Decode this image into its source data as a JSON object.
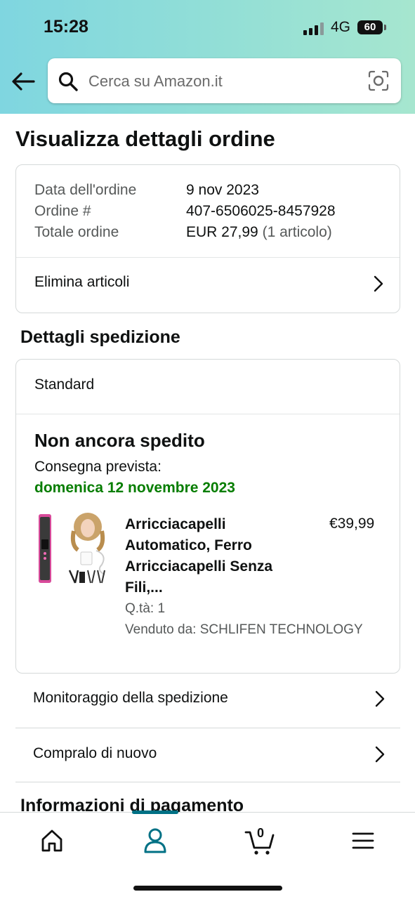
{
  "status_bar": {
    "time": "15:28",
    "network": "4G",
    "battery": "60"
  },
  "search": {
    "placeholder": "Cerca su Amazon.it"
  },
  "page": {
    "title": "Visualizza dettagli ordine"
  },
  "order": {
    "date_label": "Data dell'ordine",
    "date_value": "9 nov 2023",
    "number_label": "Ordine #",
    "number_value": "407-6506025-8457928",
    "total_label": "Totale ordine",
    "total_value": "EUR 27,99",
    "total_items": "(1 articolo)",
    "delete_items_label": "Elimina articoli"
  },
  "shipping": {
    "section_title": "Dettagli spedizione",
    "method": "Standard",
    "status": "Non ancora spedito",
    "delivery_label": "Consegna prevista:",
    "delivery_date": "domenica 12 novembre 2023",
    "product": {
      "title": "Arricciacapelli Automatico, Ferro Arricciacapelli Senza Fili,...",
      "price": "€39,99",
      "quantity": "Q.tà: 1",
      "seller": "Venduto da: SCHLIFEN TECHNOLOGY"
    }
  },
  "actions": {
    "track_label": "Monitoraggio della spedizione",
    "buy_again_label": "Compralo di nuovo"
  },
  "payment": {
    "section_title": "Informazioni di pagamento"
  },
  "tabbar": {
    "cart_count": "0",
    "active_tab": "account"
  },
  "colors": {
    "accent": "#007185",
    "delivery_green": "#067d00",
    "header_start": "#7fd6e0",
    "header_end": "#a6e6cf"
  }
}
